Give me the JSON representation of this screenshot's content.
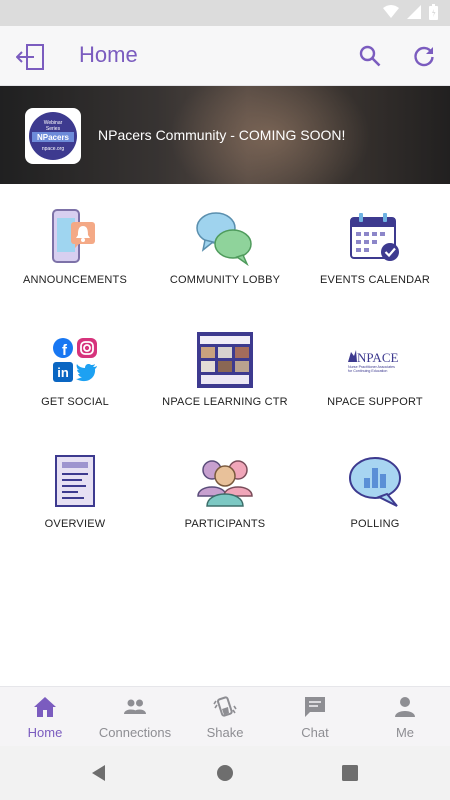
{
  "header": {
    "title": "Home"
  },
  "banner": {
    "text": "NPacers Community - COMING SOON!",
    "logo": {
      "line1": "Webinar",
      "line2": "Series",
      "brand": "NPacers",
      "url": "npace.org"
    }
  },
  "tiles": [
    {
      "label": "ANNOUNCEMENTS",
      "icon": "phone-bell-icon"
    },
    {
      "label": "COMMUNITY LOBBY",
      "icon": "chat-bubbles-icon"
    },
    {
      "label": "EVENTS CALENDAR",
      "icon": "calendar-check-icon"
    },
    {
      "label": "GET SOCIAL",
      "icon": "social-icons"
    },
    {
      "label": "NPACE LEARNING CTR",
      "icon": "learning-thumbnail"
    },
    {
      "label": "NPACE SUPPORT",
      "icon": "npace-logo"
    },
    {
      "label": "OVERVIEW",
      "icon": "document-icon"
    },
    {
      "label": "PARTICIPANTS",
      "icon": "people-icon"
    },
    {
      "label": "POLLING",
      "icon": "poll-bubble-icon"
    }
  ],
  "npace_logo": {
    "name": "NPACE",
    "tagline1": "Nurse Practitioner Associates",
    "tagline2": "for Continuing Education"
  },
  "bottom_nav": [
    {
      "label": "Home",
      "icon": "home-icon"
    },
    {
      "label": "Connections",
      "icon": "connections-icon"
    },
    {
      "label": "Shake",
      "icon": "shake-icon"
    },
    {
      "label": "Chat",
      "icon": "chat-icon"
    },
    {
      "label": "Me",
      "icon": "person-icon"
    }
  ],
  "colors": {
    "accent": "#7b5cbf",
    "nav_inactive": "#8e8e93"
  }
}
